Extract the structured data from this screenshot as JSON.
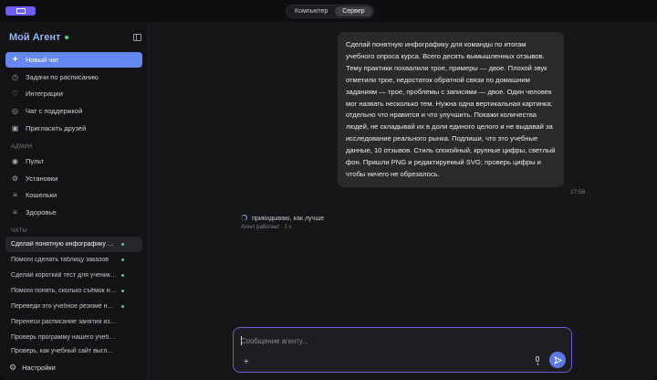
{
  "topbar": {
    "tabs": [
      {
        "label": "Компьютер",
        "active": false
      },
      {
        "label": "Сервер",
        "active": true
      }
    ]
  },
  "sidebar": {
    "brand": "Мой Агент",
    "nav": [
      {
        "label": "Новый чат",
        "icon": "plus-icon"
      },
      {
        "label": "Задачи по расписанию",
        "icon": "clock-icon"
      },
      {
        "label": "Интеграции",
        "icon": "plug-icon"
      },
      {
        "label": "Чат с поддержкой",
        "icon": "support-icon"
      },
      {
        "label": "Пригласить друзей",
        "icon": "gift-icon"
      }
    ],
    "admin_label": "АДМИН",
    "admin": [
      {
        "label": "Пульт",
        "icon": "dashboard-icon"
      },
      {
        "label": "Установки",
        "icon": "gear-icon"
      },
      {
        "label": "Кошельки",
        "icon": "wallet-icon"
      },
      {
        "label": "Здоровье",
        "icon": "health-icon"
      }
    ],
    "chats_label": "ЧАТЫ",
    "chats": [
      {
        "title": "Сделай понятную инфографику для команды по итогам учебного опроса курса",
        "dot": true,
        "active": true
      },
      {
        "title": "Помоги сделать таблицу заказов",
        "dot": true,
        "active": false
      },
      {
        "title": "Сделай короткий тест для учеников",
        "dot": true,
        "active": false
      },
      {
        "title": "Помоги понять, сколько съёмок нужно",
        "dot": true,
        "active": false
      },
      {
        "title": "Переведи это учебное резюме на английский",
        "dot": true,
        "active": false
      },
      {
        "title": "Перенеси расписание занятия из экселя",
        "dot": false,
        "active": false
      },
      {
        "title": "Проверь программу нашего учебного курса",
        "dot": false,
        "active": false
      },
      {
        "title": "Проверь, как учебный сайт выглядит",
        "dot": false,
        "active": false
      }
    ],
    "settings_label": "Настройки"
  },
  "main": {
    "message": "Сделай понятную инфографику для команды по итогам учебного опроса курса. Всего десять вымышленных отзывов. Тему практики похвалили трое, примеры — двое. Плохой звук отметили трое, недостаток обратной связи по домашним заданиям — трое, проблемы с записями — двое. Один человек мог назвать несколько тем. Нужна одна вертикальная картинка: отдельно что нравится и что улучшить. Покажи количества людей, не складывай их в доли единого целого и не выдавай за исследование реального рынка. Подпиши, что это учебные данные, 10 отзывов. Стиль спокойный, крупные цифры, светлый фон. Пришли PNG и редактируемый SVG; проверь цифры и чтобы ничего не обрезалось.",
    "time": "17:58",
    "thinking": "прикидываю, как лучше",
    "status": "Агент работает · 1 с",
    "composer_placeholder": "Сообщение агенту..."
  },
  "colors": {
    "accent": "#6488f0",
    "brand": "#8fb6ff",
    "online": "#4fd47a",
    "composer_border": "#6a5cd6"
  }
}
